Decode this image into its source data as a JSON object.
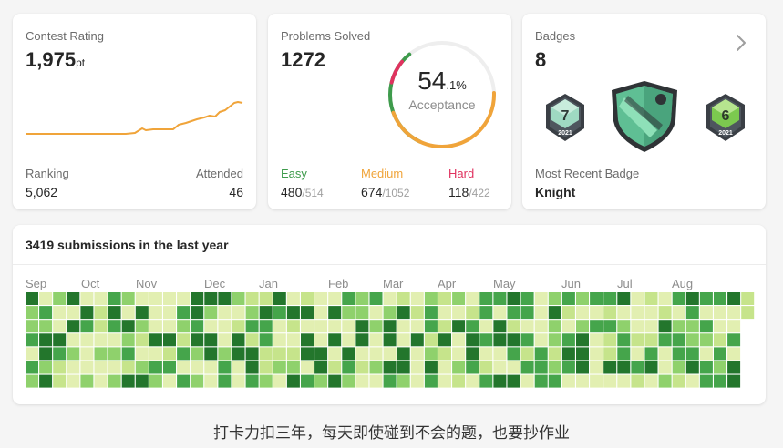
{
  "colors": {
    "heat_levels": [
      "#e2efb1",
      "#c6e48b",
      "#8fd16c",
      "#45a54b",
      "#23762c"
    ],
    "rating_line": "#f0a43a",
    "easy": "#3e9b4c",
    "medium": "#f0a43a",
    "hard": "#e0325f"
  },
  "contest": {
    "title": "Contest Rating",
    "rating": "1,975",
    "rating_unit": "pt",
    "ranking_label": "Ranking",
    "ranking_value": "5,062",
    "attended_label": "Attended",
    "attended_value": "46"
  },
  "solved": {
    "title": "Problems Solved",
    "total": "1272",
    "acceptance_int": "54",
    "acceptance_dec": ".1%",
    "acceptance_label": "Acceptance",
    "ring": {
      "easy_pct": 38,
      "medium_pct": 53,
      "hard_pct": 9,
      "gap_pct": 14
    },
    "easy": {
      "label": "Easy",
      "solved": "480",
      "total": "514"
    },
    "medium": {
      "label": "Medium",
      "solved": "674",
      "total": "1052"
    },
    "hard": {
      "label": "Hard",
      "solved": "118",
      "total": "422"
    }
  },
  "badges": {
    "title": "Badges",
    "count": "8",
    "chevron_icon": "chevron-right-icon",
    "items": [
      {
        "icon": "badge-icon",
        "number": "7",
        "year": "2021"
      },
      {
        "icon": "knight-badge-icon"
      },
      {
        "icon": "badge-icon",
        "number": "6",
        "year": "2021"
      }
    ],
    "recent_label": "Most Recent Badge",
    "recent_value": "Knight"
  },
  "heatmap": {
    "title": "3419 submissions in the last year",
    "months": [
      "Sep",
      "Oct",
      "Nov",
      "Dec",
      "Jan",
      "Feb",
      "Mar",
      "Apr",
      "May",
      "Jun",
      "Jul",
      "Aug"
    ],
    "weeks": 53,
    "days": 7,
    "last_week_days": 2
  },
  "caption": "打卡力扣三年，每天即使碰到不会的题，也要抄作业"
}
